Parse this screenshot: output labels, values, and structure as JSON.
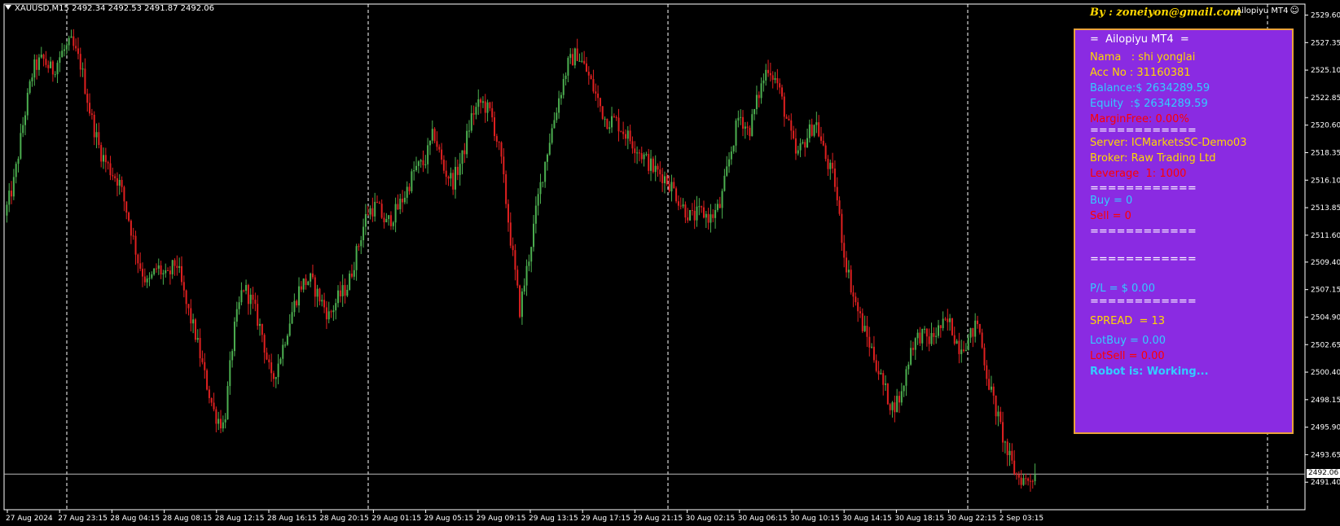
{
  "header": {
    "symbol_line": "XAUUSD,M15  2492.34 2492.53 2491.87 2492.06",
    "ea_name": "Ailopiyu MT4",
    "byline": "By : zoneiyon@gmail.com"
  },
  "panel": {
    "title": "=  Ailopiyu MT4  =",
    "lines": [
      {
        "text": "Nama   : shi yonglai",
        "color": "#ffd700"
      },
      {
        "text": "Acc No : 31160381",
        "color": "#ffd700"
      },
      {
        "text": "Balance:$ 2634289.59",
        "color": "#33ccff"
      },
      {
        "text": "Equity  :$ 2634289.59",
        "color": "#33ccff"
      },
      {
        "text": "MarginFree: 0.00%",
        "color": "#ff0000"
      },
      {
        "text": "============",
        "color": "#ffffff"
      },
      {
        "text": "Server: ICMarketsSC-Demo03",
        "color": "#ffd700"
      },
      {
        "text": "Broker: Raw Trading Ltd",
        "color": "#ffd700"
      },
      {
        "text": "Leverage  1: 1000",
        "color": "#ff0000"
      },
      {
        "text": "============",
        "color": "#ffffff"
      },
      {
        "text": "Buy = 0",
        "color": "#33ccff"
      },
      {
        "text": "Sell = 0",
        "color": "#ff0000"
      },
      {
        "text": "============",
        "color": "#ffffff"
      },
      {
        "text": "============",
        "color": "#ffffff"
      },
      {
        "text": "P/L = $ 0.00",
        "color": "#33ccff"
      },
      {
        "text": "============",
        "color": "#ffffff"
      },
      {
        "text": "SPREAD  = 13",
        "color": "#ffd700"
      },
      {
        "text": "LotBuy = 0.00",
        "color": "#33ccff"
      },
      {
        "text": "LotSell = 0.00",
        "color": "#ff0000"
      },
      {
        "text": "Robot is: Working...",
        "color": "#33ccff",
        "bold": true
      }
    ]
  },
  "current_price_label": "2492.06",
  "colors": {
    "background": "#000000",
    "bull_candle": "#4caf50",
    "bear_candle": "#e02020",
    "panel_bg": "#8a2be2",
    "panel_border": "#e9a23b",
    "grid": "#ffffff"
  },
  "chart_data": {
    "type": "line",
    "x_ticks": [
      "27 Aug 2024",
      "27 Aug 23:15",
      "28 Aug 04:15",
      "28 Aug 08:15",
      "28 Aug 12:15",
      "28 Aug 16:15",
      "28 Aug 20:15",
      "29 Aug 01:15",
      "29 Aug 05:15",
      "29 Aug 09:15",
      "29 Aug 13:15",
      "29 Aug 17:15",
      "29 Aug 21:15",
      "30 Aug 02:15",
      "30 Aug 06:15",
      "30 Aug 10:15",
      "30 Aug 14:15",
      "30 Aug 18:15",
      "30 Aug 22:15",
      "2 Sep 03:15"
    ],
    "y_ticks": [
      "2529.60",
      "2527.35",
      "2525.10",
      "2522.85",
      "2520.60",
      "2518.35",
      "2516.10",
      "2513.85",
      "2511.60",
      "2509.40",
      "2507.15",
      "2504.90",
      "2502.65",
      "2500.40",
      "2498.15",
      "2495.90",
      "2493.65",
      "2491.40"
    ],
    "ylim": [
      2489.15,
      2530.5
    ],
    "current_price": 2492.06,
    "close_path": [
      2513.2,
      2516.0,
      2521.0,
      2525.2,
      2526.0,
      2525.0,
      2526.5,
      2527.3,
      2525.5,
      2521.5,
      2518.5,
      2517.0,
      2516.0,
      2513.0,
      2509.5,
      2507.5,
      2509.0,
      2508.0,
      2509.5,
      2506.0,
      2503.5,
      2500.0,
      2497.0,
      2496.0,
      2503.5,
      2507.5,
      2506.0,
      2503.5,
      2499.5,
      2502.0,
      2505.0,
      2507.5,
      2508.0,
      2506.5,
      2505.0,
      2506.5,
      2507.5,
      2510.5,
      2513.5,
      2514.0,
      2512.5,
      2513.5,
      2515.0,
      2517.0,
      2517.5,
      2520.0,
      2517.0,
      2516.0,
      2518.0,
      2521.5,
      2522.5,
      2521.5,
      2518.0,
      2511.5,
      2505.5,
      2510.0,
      2515.0,
      2519.0,
      2522.5,
      2525.5,
      2526.5,
      2525.0,
      2523.0,
      2521.0,
      2521.0,
      2520.0,
      2519.0,
      2518.0,
      2517.0,
      2516.5,
      2515.5,
      2514.0,
      2513.0,
      2513.5,
      2513.0,
      2514.0,
      2518.0,
      2521.5,
      2520.0,
      2523.0,
      2525.5,
      2524.0,
      2521.0,
      2518.0,
      2519.5,
      2521.0,
      2518.0,
      2516.0,
      2510.0,
      2506.5,
      2504.0,
      2502.0,
      2499.5,
      2497.5,
      2498.5,
      2502.5,
      2503.5,
      2503.0,
      2504.0,
      2504.5,
      2502.5,
      2503.0,
      2504.5,
      2500.0,
      2497.0,
      2494.0,
      2492.0,
      2491.5,
      2492.06
    ]
  }
}
